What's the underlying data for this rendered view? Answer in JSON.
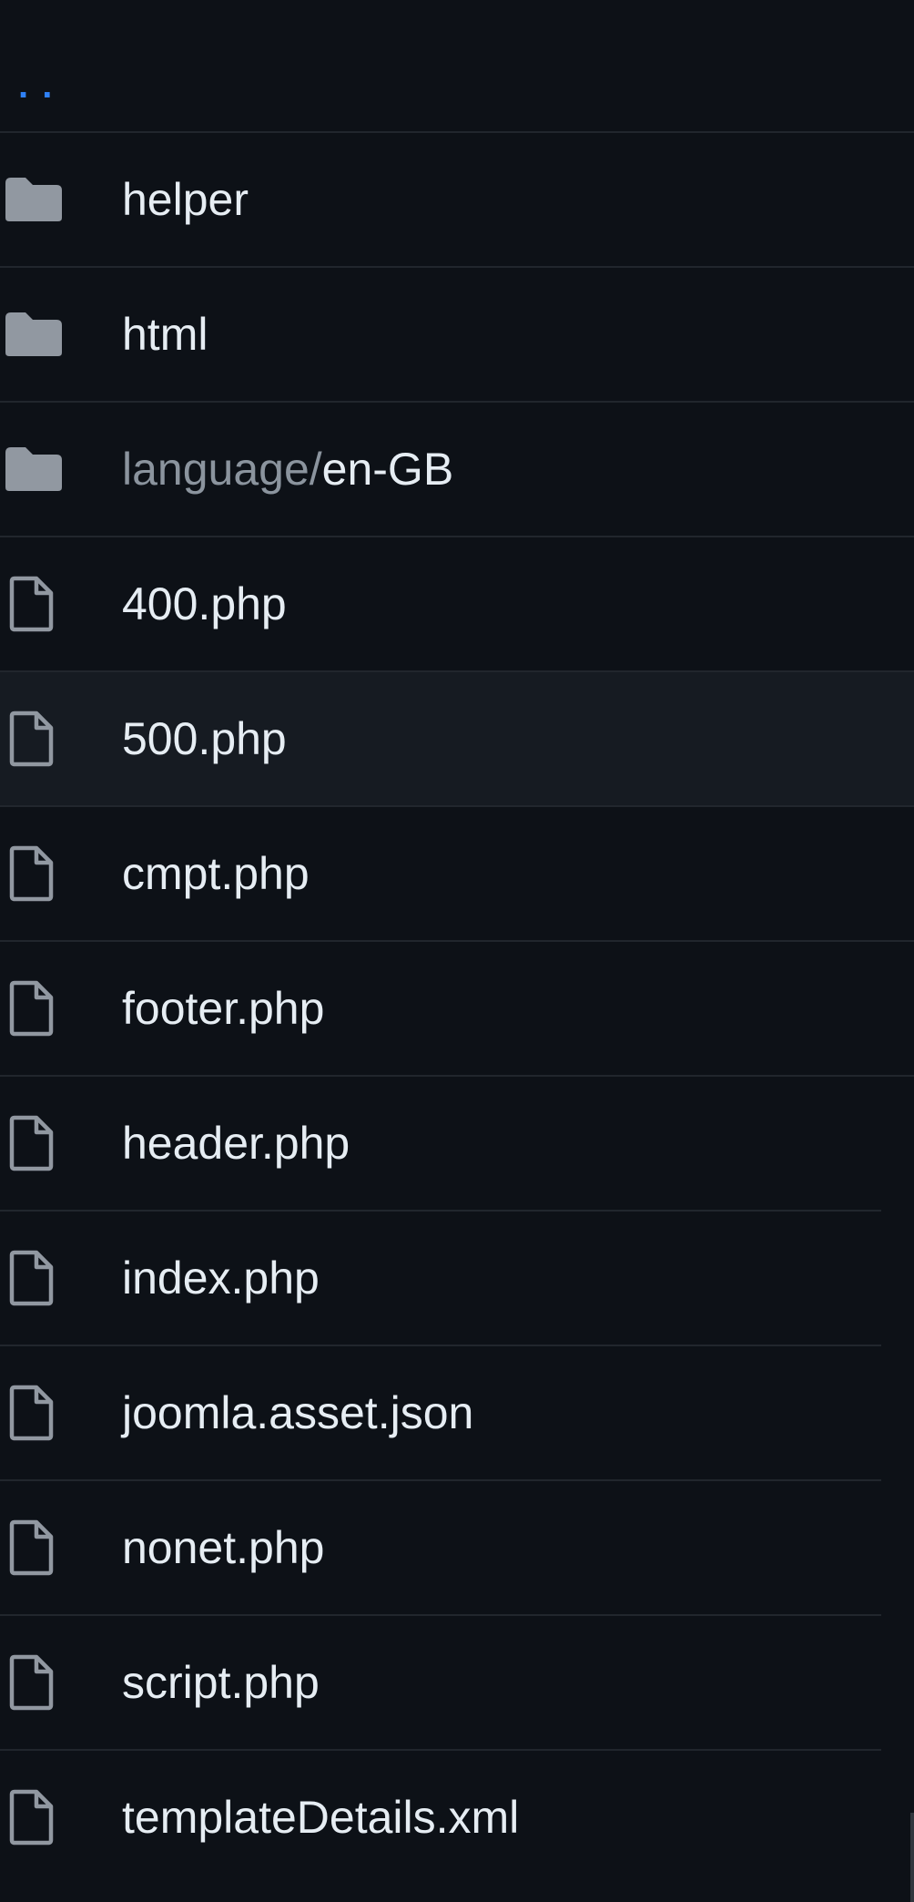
{
  "parent_link": {
    "label": ". ."
  },
  "items": [
    {
      "type": "folder",
      "icon": "folder-icon",
      "name": "helper",
      "prefix": ""
    },
    {
      "type": "folder",
      "icon": "folder-icon",
      "name": "html",
      "prefix": ""
    },
    {
      "type": "folder",
      "icon": "folder-icon",
      "name": "en-GB",
      "prefix": "language/"
    },
    {
      "type": "file",
      "icon": "file-icon",
      "name": "400.php",
      "prefix": ""
    },
    {
      "type": "file",
      "icon": "file-icon",
      "name": "500.php",
      "prefix": ""
    },
    {
      "type": "file",
      "icon": "file-icon",
      "name": "cmpt.php",
      "prefix": ""
    },
    {
      "type": "file",
      "icon": "file-icon",
      "name": "footer.php",
      "prefix": ""
    },
    {
      "type": "file",
      "icon": "file-icon",
      "name": "header.php",
      "prefix": ""
    },
    {
      "type": "file",
      "icon": "file-icon",
      "name": "index.php",
      "prefix": ""
    },
    {
      "type": "file",
      "icon": "file-icon",
      "name": "joomla.asset.json",
      "prefix": ""
    },
    {
      "type": "file",
      "icon": "file-icon",
      "name": "nonet.php",
      "prefix": ""
    },
    {
      "type": "file",
      "icon": "file-icon",
      "name": "script.php",
      "prefix": ""
    },
    {
      "type": "file",
      "icon": "file-icon",
      "name": "templateDetails.xml",
      "prefix": ""
    }
  ],
  "colors": {
    "background": "#0d1117",
    "hover_row": "#161b22",
    "border": "#21262d",
    "link": "#2f81f7",
    "text": "#e6edf3",
    "muted": "#8b949e",
    "folder_icon": "#9198a1"
  }
}
